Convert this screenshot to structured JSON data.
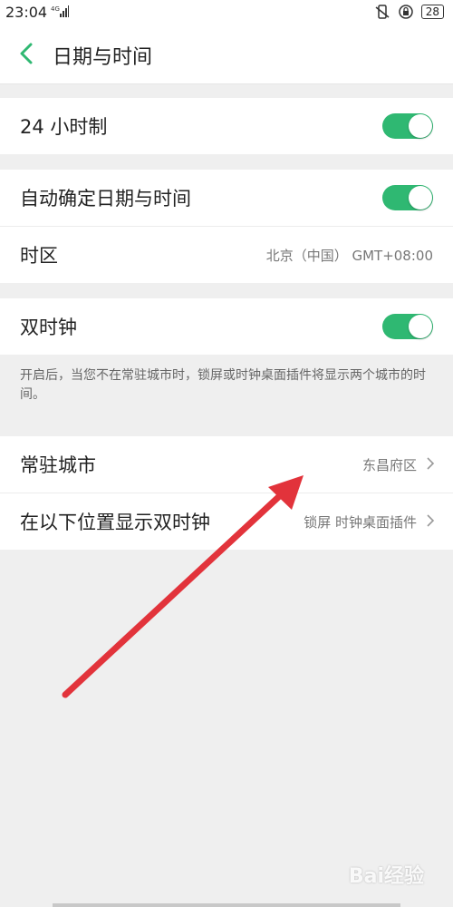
{
  "status_bar": {
    "time": "23:04",
    "battery": "28",
    "network": "4G"
  },
  "header": {
    "title": "日期与时间"
  },
  "groups": {
    "g1": {
      "hour24": {
        "label": "24 小时制",
        "toggle_on": true
      }
    },
    "g2": {
      "auto": {
        "label": "自动确定日期与时间",
        "toggle_on": true
      },
      "timezone": {
        "label": "时区",
        "value": "北京（中国） GMT+08:00"
      }
    },
    "g3": {
      "dual": {
        "label": "双时钟",
        "toggle_on": true
      }
    },
    "description": "开启后，当您不在常驻城市时，锁屏或时钟桌面插件将显示两个城市的时间。",
    "g4": {
      "resident_city": {
        "label": "常驻城市",
        "value": "东昌府区"
      },
      "show_dual": {
        "label": "在以下位置显示双时钟",
        "value": "锁屏 时钟桌面插件"
      }
    }
  },
  "watermark": "Bai经验",
  "colors": {
    "accent": "#2fb872",
    "arrow": "#e2333b",
    "background": "#efefef"
  }
}
